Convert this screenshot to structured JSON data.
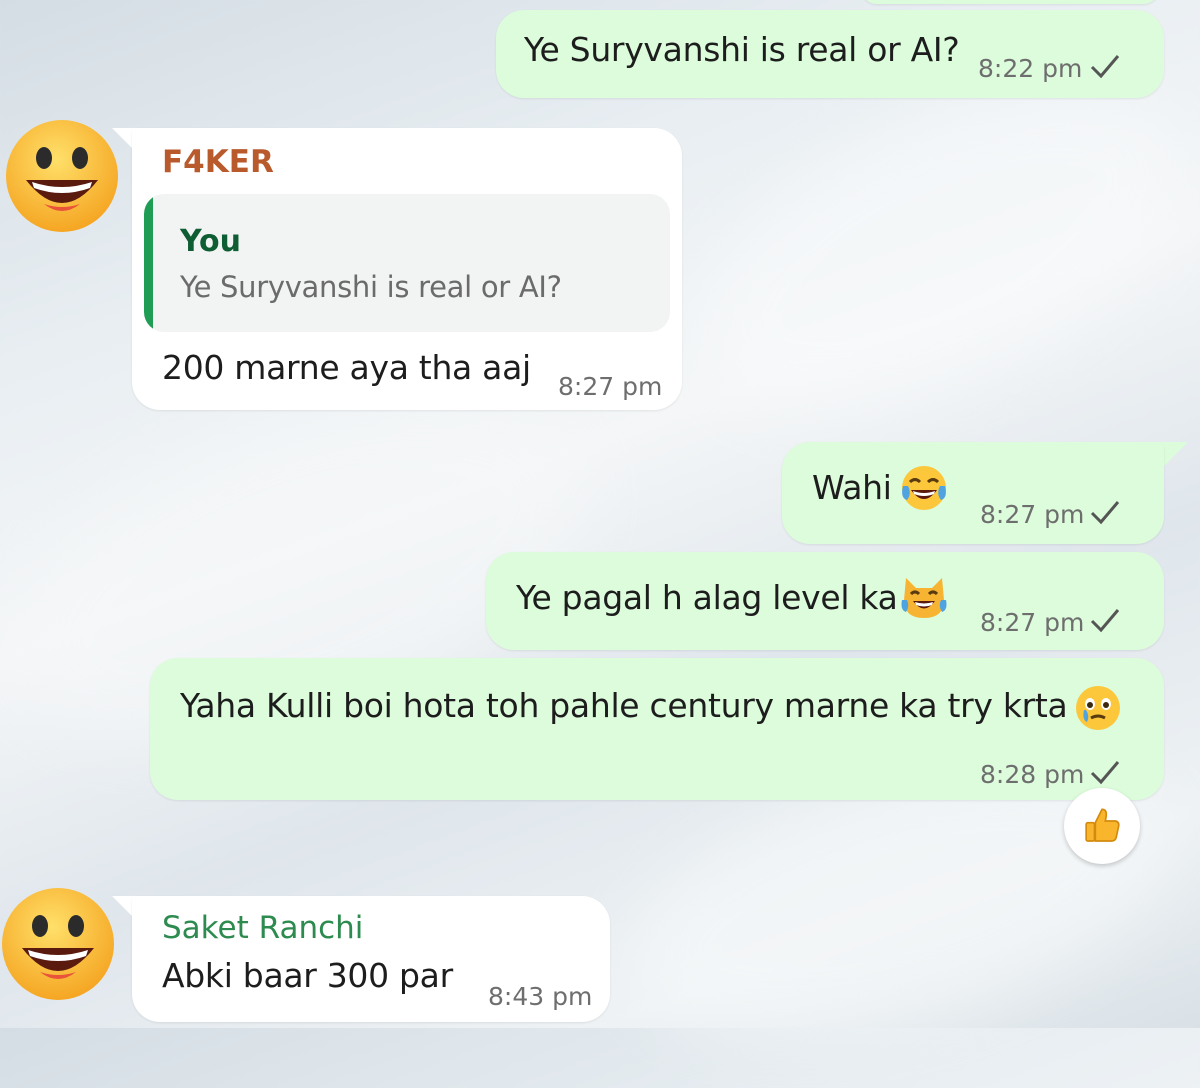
{
  "messages": [
    {
      "text": "Ye Suryvanshi is real or AI?",
      "time": "8:22 pm",
      "status": "sent"
    },
    {
      "sender": "F4KER",
      "sender_color": "#b85a2c",
      "quote": {
        "author": "You",
        "text": "Ye Suryvanshi is real or AI?"
      },
      "text": "200 marne aya tha aaj",
      "time": "8:27 pm"
    },
    {
      "text": "Wahi",
      "emoji": "face-with-tears-of-joy",
      "time": "8:27 pm",
      "status": "sent"
    },
    {
      "text": "Ye pagal h alag level ka",
      "emoji": "cat-with-tears-of-joy",
      "time": "8:27 pm",
      "status": "sent"
    },
    {
      "text": "Yaha Kulli boi hota toh pahle century marne ka try krta",
      "emoji": "face-holding-back-tears",
      "time": "8:28 pm",
      "status": "sent",
      "reaction": "thumbs-up"
    },
    {
      "sender": "Saket Ranchi",
      "sender_color": "#2e8b50",
      "text": "Abki baar 300 par",
      "time": "8:43 pm"
    }
  ],
  "colors": {
    "outgoing_bubble": "#dcfcdc",
    "incoming_bubble": "#ffffff",
    "quote_bar": "#1f9d55",
    "quote_author": "#0f5d33"
  }
}
